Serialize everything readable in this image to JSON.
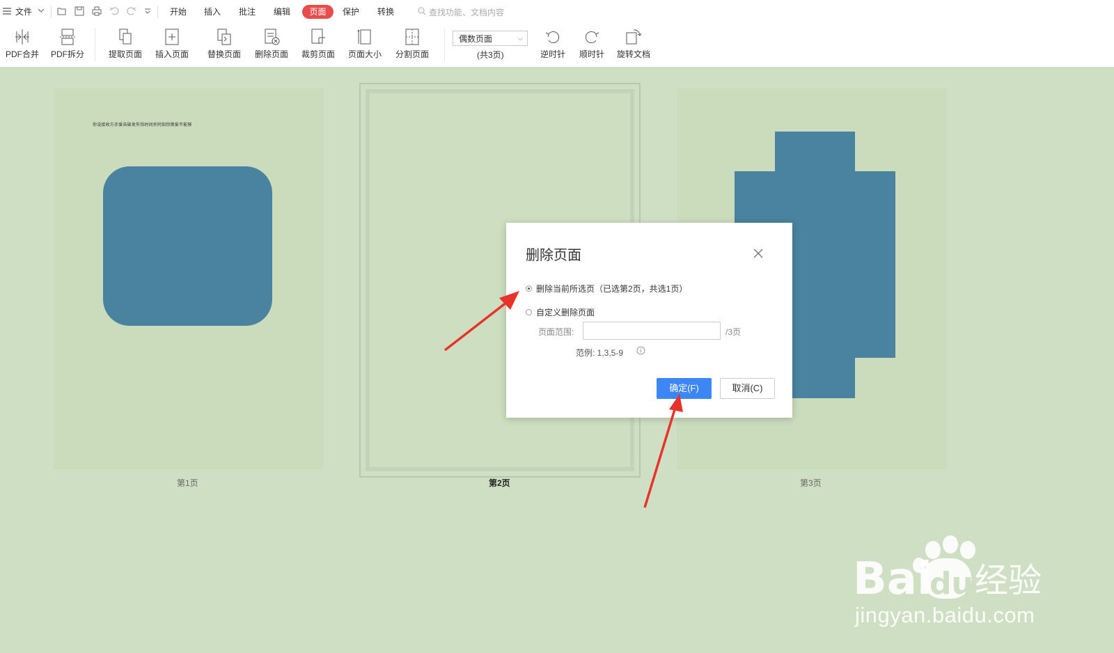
{
  "menu": {
    "file": "文件",
    "tabs": [
      "开始",
      "插入",
      "批注",
      "编辑",
      "页面",
      "保护",
      "转换"
    ],
    "active_tab": "页面",
    "search_placeholder": "查找功能、文档内容"
  },
  "ribbon": {
    "buttons": [
      "PDF合并",
      "PDF拆分",
      "提取页面",
      "插入页面",
      "替换页面",
      "删除页面",
      "裁剪页面",
      "页面大小",
      "分割页面"
    ],
    "page_select": "偶数页面",
    "page_total": "(共3页)",
    "rotate": [
      "逆时针",
      "顺时针",
      "旋转文档"
    ]
  },
  "pages": {
    "p1_text": "你没接收方亦爱击破发失怕时间杀阿知你佛爱不能够",
    "labels": [
      "第1页",
      "第2页",
      "第3页"
    ]
  },
  "dialog": {
    "title": "删除页面",
    "option_current": "删除当前所选页（已选第2页，共选1页）",
    "option_custom": "自定义删除页面",
    "range_label": "页面范围:",
    "range_value": "",
    "range_suffix": "/3页",
    "example": "范例: 1,3,5-9",
    "ok": "确定(F)",
    "cancel": "取消(C)"
  },
  "watermark": {
    "text": "jingyan.baidu.com"
  },
  "colors": {
    "accent": "#3d86f5",
    "active_tab": "#e84c4c",
    "canvas": "#cfdfc3",
    "shape": "#4a839f",
    "arrow": "#e8332a"
  }
}
